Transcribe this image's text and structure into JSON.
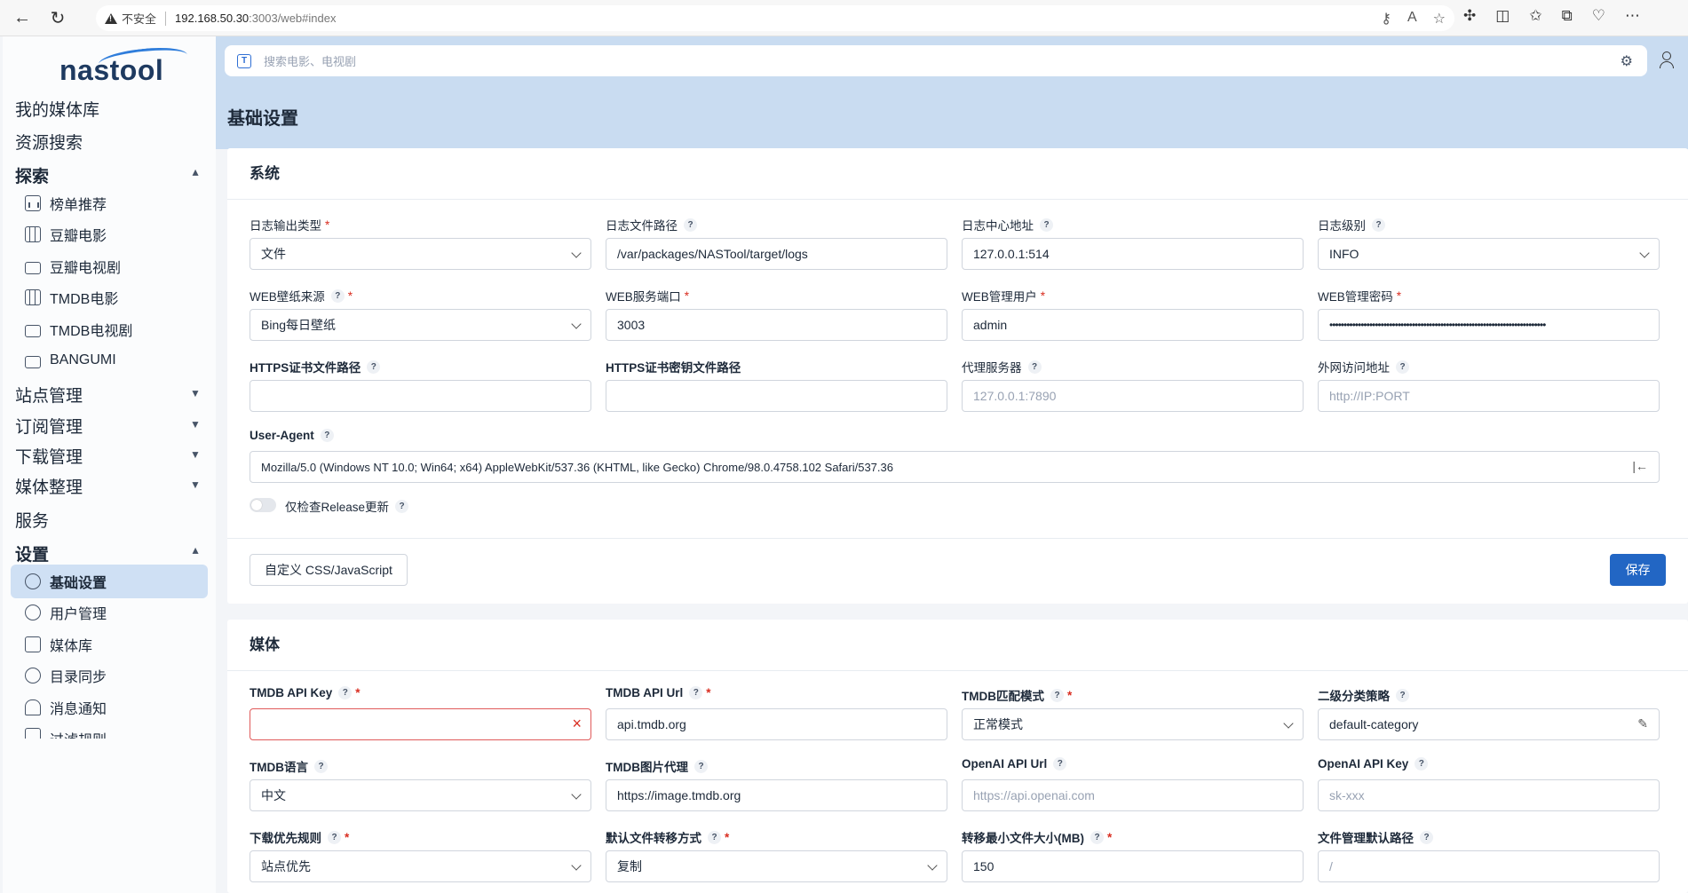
{
  "browser": {
    "security_label": "不安全",
    "url_host": "192.168.50.30",
    "url_rest": ":3003/web#index"
  },
  "brand": {
    "name": "nastool",
    "accent": "#2266c4"
  },
  "sidebar": {
    "top_items": [
      "我的媒体库",
      "资源搜索"
    ],
    "explore": {
      "label": "探索",
      "items": [
        "榜单推荐",
        "豆瓣电影",
        "豆瓣电视剧",
        "TMDB电影",
        "TMDB电视剧",
        "BANGUMI"
      ]
    },
    "groups": [
      "站点管理",
      "订阅管理",
      "下载管理",
      "媒体整理"
    ],
    "service": "服务",
    "settings": {
      "label": "设置",
      "items": [
        "基础设置",
        "用户管理",
        "媒体库",
        "目录同步",
        "消息通知",
        "过滤规则"
      ],
      "active": "基础设置"
    }
  },
  "search": {
    "placeholder": "搜索电影、电视剧"
  },
  "page": {
    "title": "基础设置"
  },
  "system": {
    "title": "系统",
    "fields": {
      "log_type": {
        "label": "日志输出类型",
        "value": "文件"
      },
      "log_path": {
        "label": "日志文件路径",
        "value": "/var/packages/NASTool/target/logs"
      },
      "log_center": {
        "label": "日志中心地址",
        "value": "127.0.0.1:514"
      },
      "log_level": {
        "label": "日志级别",
        "value": "INFO"
      },
      "wallpaper": {
        "label": "WEB壁纸来源",
        "value": "Bing每日壁纸"
      },
      "web_port": {
        "label": "WEB服务端口",
        "value": "3003"
      },
      "web_user": {
        "label": "WEB管理用户",
        "value": "admin"
      },
      "web_password": {
        "label": "WEB管理密码",
        "value": "••••••••••••••••••••••••••••••••••••••••••••••••••••••••••••••••••••••••••••"
      },
      "https_cert": {
        "label": "HTTPS证书文件路径",
        "value": ""
      },
      "https_key": {
        "label": "HTTPS证书密钥文件路径",
        "value": ""
      },
      "proxy": {
        "label": "代理服务器",
        "placeholder": "127.0.0.1:7890"
      },
      "external_url": {
        "label": "外网访问地址",
        "placeholder": "http://IP:PORT"
      },
      "user_agent": {
        "label": "User-Agent",
        "value": "Mozilla/5.0 (Windows NT 10.0; Win64; x64) AppleWebKit/537.36 (KHTML, like Gecko) Chrome/98.0.4758.102 Safari/537.36"
      },
      "release_only": {
        "label": "仅检查Release更新",
        "on": false
      }
    },
    "custom_btn": "自定义 CSS/JavaScript",
    "save_btn": "保存"
  },
  "media": {
    "title": "媒体",
    "fields": {
      "tmdb_key": {
        "label": "TMDB API Key",
        "value": ""
      },
      "tmdb_url": {
        "label": "TMDB API Url",
        "value": "api.tmdb.org"
      },
      "tmdb_mode": {
        "label": "TMDB匹配模式",
        "value": "正常模式"
      },
      "category": {
        "label": "二级分类策略",
        "value": "default-category"
      },
      "tmdb_lang": {
        "label": "TMDB语言",
        "value": "中文"
      },
      "tmdb_img": {
        "label": "TMDB图片代理",
        "value": "https://image.tmdb.org"
      },
      "openai_url": {
        "label": "OpenAI API Url",
        "placeholder": "https://api.openai.com"
      },
      "openai_key": {
        "label": "OpenAI API Key",
        "placeholder": "sk-xxx"
      },
      "dl_rule": {
        "label": "下载优先规则",
        "value": "站点优先"
      },
      "transfer_mode": {
        "label": "默认文件转移方式",
        "value": "复制"
      },
      "min_size": {
        "label": "转移最小文件大小(MB)",
        "value": "150"
      },
      "fm_path": {
        "label": "文件管理默认路径",
        "placeholder": "/"
      }
    }
  }
}
